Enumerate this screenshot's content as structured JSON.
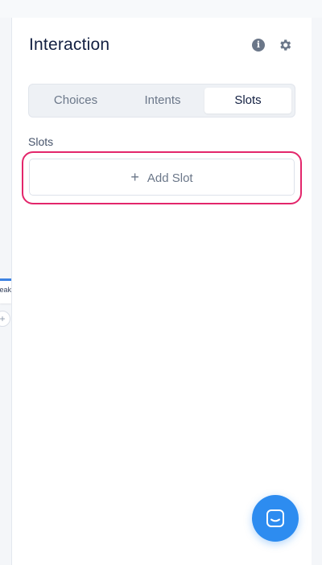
{
  "panel": {
    "title": "Interaction",
    "icons": [
      "info-icon",
      "gear-icon"
    ]
  },
  "tabs": [
    {
      "label": "Choices",
      "active": false
    },
    {
      "label": "Intents",
      "active": false
    },
    {
      "label": "Slots",
      "active": true
    }
  ],
  "slots": {
    "section_label": "Slots",
    "add_button": {
      "icon": "plus-icon",
      "label": "Add Slot"
    }
  },
  "canvas": {
    "node_label_fragment": "peak",
    "add_step_symbol": "+"
  },
  "chat_launcher": {
    "icon": "chat-bubble-icon"
  },
  "colors": {
    "highlight": "#e3266b",
    "chat_launcher": "#2d8cf0",
    "node_accent": "#3d82e2"
  }
}
